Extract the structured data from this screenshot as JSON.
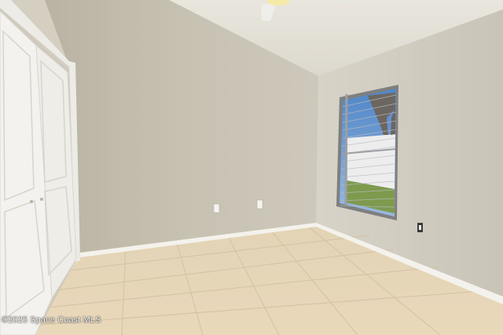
{
  "photo": {
    "watermark": "©2025 Space Coast MLS"
  }
}
